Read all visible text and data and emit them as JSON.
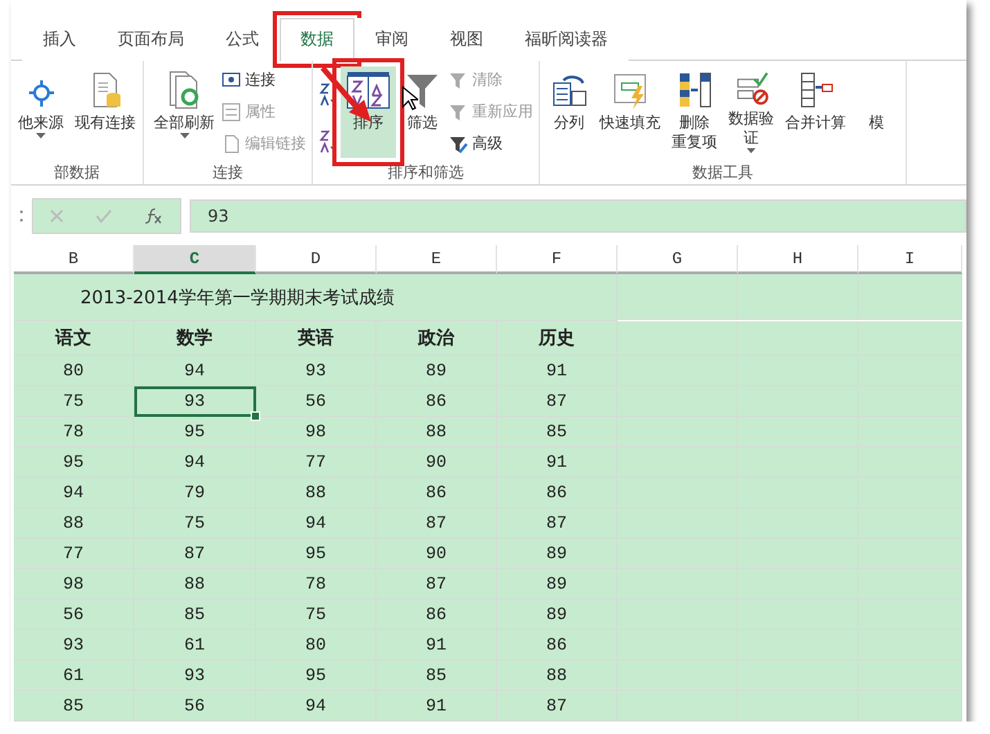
{
  "tabs": [
    {
      "label": "插入",
      "selected": false,
      "marked": false
    },
    {
      "label": "页面布局",
      "selected": false,
      "marked": false
    },
    {
      "label": "公式",
      "selected": false,
      "marked": false
    },
    {
      "label": "数据",
      "selected": true,
      "marked": true
    },
    {
      "label": "审阅",
      "selected": false,
      "marked": false
    },
    {
      "label": "视图",
      "selected": false,
      "marked": false
    },
    {
      "label": "福昕阅读器",
      "selected": false,
      "marked": false
    }
  ],
  "ribbon_groups": [
    {
      "label": "部数据",
      "items": [
        {
          "kind": "large",
          "lines": [
            "他来源"
          ],
          "dropdown": true
        },
        {
          "kind": "large",
          "lines": [
            "现有连接"
          ]
        }
      ]
    },
    {
      "label": "连接",
      "items": [
        {
          "kind": "large",
          "lines": [
            "全部刷新"
          ],
          "dropdown": true
        },
        {
          "kind": "small",
          "label": "连接",
          "disabled": false
        },
        {
          "kind": "small",
          "label": "属性",
          "disabled": true
        },
        {
          "kind": "small",
          "label": "编辑链接",
          "disabled": true
        }
      ]
    },
    {
      "label": "排序和筛选",
      "items": [
        {
          "kind": "icon"
        },
        {
          "kind": "icon"
        },
        {
          "kind": "large",
          "lines": [
            "排序"
          ],
          "highlighted": true,
          "marked": true
        },
        {
          "kind": "large",
          "lines": [
            "筛选"
          ]
        },
        {
          "kind": "small",
          "label": "清除",
          "disabled": true
        },
        {
          "kind": "small",
          "label": "重新应用",
          "disabled": true
        },
        {
          "kind": "small",
          "label": "高级",
          "disabled": false
        }
      ]
    },
    {
      "label": "数据工具",
      "items": [
        {
          "kind": "large",
          "lines": [
            "分列"
          ]
        },
        {
          "kind": "large",
          "lines": [
            "快速填充"
          ]
        },
        {
          "kind": "large",
          "lines": [
            "删除",
            "重复项"
          ]
        },
        {
          "kind": "large",
          "lines": [
            "数据验",
            "证"
          ],
          "dropdown": true
        },
        {
          "kind": "large",
          "lines": [
            "合并计算"
          ]
        },
        {
          "kind": "large",
          "lines": [
            "模"
          ]
        }
      ]
    }
  ],
  "formula_bar": {
    "value": "93"
  },
  "columns": [
    {
      "label": "B",
      "selected": false
    },
    {
      "label": "C",
      "selected": true
    },
    {
      "label": "D",
      "selected": false
    },
    {
      "label": "E",
      "selected": false
    },
    {
      "label": "F",
      "selected": false
    },
    {
      "label": "G",
      "selected": false
    },
    {
      "label": "H",
      "selected": false
    },
    {
      "label": "I",
      "selected": false
    }
  ],
  "sheet_title": "2013-2014学年第一学期期末考试成绩",
  "headers": [
    "语文",
    "数学",
    "英语",
    "政治",
    "历史"
  ],
  "rows": [
    {
      "cells": [
        {
          "text": "80",
          "selected": false
        },
        {
          "text": "94",
          "selected": false
        },
        {
          "text": "93",
          "selected": false
        },
        {
          "text": "89",
          "selected": false
        },
        {
          "text": "91",
          "selected": false
        }
      ]
    },
    {
      "cells": [
        {
          "text": "75",
          "selected": false
        },
        {
          "text": "93",
          "selected": true
        },
        {
          "text": "56",
          "selected": false
        },
        {
          "text": "86",
          "selected": false
        },
        {
          "text": "87",
          "selected": false
        }
      ]
    },
    {
      "cells": [
        {
          "text": "78",
          "selected": false
        },
        {
          "text": "95",
          "selected": false
        },
        {
          "text": "98",
          "selected": false
        },
        {
          "text": "88",
          "selected": false
        },
        {
          "text": "85",
          "selected": false
        }
      ]
    },
    {
      "cells": [
        {
          "text": "95",
          "selected": false
        },
        {
          "text": "94",
          "selected": false
        },
        {
          "text": "77",
          "selected": false
        },
        {
          "text": "90",
          "selected": false
        },
        {
          "text": "91",
          "selected": false
        }
      ]
    },
    {
      "cells": [
        {
          "text": "94",
          "selected": false
        },
        {
          "text": "79",
          "selected": false
        },
        {
          "text": "88",
          "selected": false
        },
        {
          "text": "86",
          "selected": false
        },
        {
          "text": "86",
          "selected": false
        }
      ]
    },
    {
      "cells": [
        {
          "text": "88",
          "selected": false
        },
        {
          "text": "75",
          "selected": false
        },
        {
          "text": "94",
          "selected": false
        },
        {
          "text": "87",
          "selected": false
        },
        {
          "text": "87",
          "selected": false
        }
      ]
    },
    {
      "cells": [
        {
          "text": "77",
          "selected": false
        },
        {
          "text": "87",
          "selected": false
        },
        {
          "text": "95",
          "selected": false
        },
        {
          "text": "90",
          "selected": false
        },
        {
          "text": "89",
          "selected": false
        }
      ]
    },
    {
      "cells": [
        {
          "text": "98",
          "selected": false
        },
        {
          "text": "88",
          "selected": false
        },
        {
          "text": "78",
          "selected": false
        },
        {
          "text": "87",
          "selected": false
        },
        {
          "text": "89",
          "selected": false
        }
      ]
    },
    {
      "cells": [
        {
          "text": "56",
          "selected": false
        },
        {
          "text": "85",
          "selected": false
        },
        {
          "text": "75",
          "selected": false
        },
        {
          "text": "86",
          "selected": false
        },
        {
          "text": "89",
          "selected": false
        }
      ]
    },
    {
      "cells": [
        {
          "text": "93",
          "selected": false
        },
        {
          "text": "61",
          "selected": false
        },
        {
          "text": "80",
          "selected": false
        },
        {
          "text": "91",
          "selected": false
        },
        {
          "text": "86",
          "selected": false
        }
      ]
    },
    {
      "cells": [
        {
          "text": "61",
          "selected": false
        },
        {
          "text": "93",
          "selected": false
        },
        {
          "text": "95",
          "selected": false
        },
        {
          "text": "85",
          "selected": false
        },
        {
          "text": "88",
          "selected": false
        }
      ]
    },
    {
      "cells": [
        {
          "text": "85",
          "selected": false
        },
        {
          "text": "56",
          "selected": false
        },
        {
          "text": "94",
          "selected": false
        },
        {
          "text": "91",
          "selected": false
        },
        {
          "text": "87",
          "selected": false
        }
      ]
    }
  ]
}
